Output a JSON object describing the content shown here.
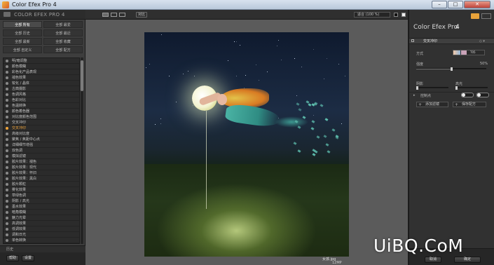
{
  "window": {
    "title": "Color Efex Pro 4",
    "min_label": "–",
    "max_label": "□",
    "close_label": "✕"
  },
  "left": {
    "title": "COLOR EFEX PRO 4",
    "categories": [
      "全部 所有",
      "全部 最爱",
      "全部 历史",
      "全部 最近",
      "全部 最新",
      "全部 收藏",
      "全部 自定义",
      "全部 配方"
    ],
    "filters": [
      "明/暗调整",
      "颜色模糊",
      "彩色化产品表现",
      "褪色效果",
      "锐化 / 晶体",
      "古典摄影",
      "色调风格",
      "色彩对比",
      "色温转换",
      "颜色着色器",
      "对比度颜色范围",
      "交叉冲印",
      "交叉冲印",
      "高级对比度",
      "聚焦 / 焦距中心点",
      "详细细节增强",
      "双色调",
      "模拟滤镜",
      "胶片效果：褪色",
      "胶片效果：现代",
      "胶片效果：怀旧",
      "胶片效果：黑白",
      "胶片颗粒",
      "雾化效果",
      "草绿色调",
      "阴影 / 高光",
      "墨水效果",
      "暗角模糊",
      "魅力光晕",
      "高调效果",
      "低调效果",
      "调和日光",
      "单色转换",
      "单色：黑白转换"
    ],
    "selected_filter": "交叉冲印",
    "history_label": "历史",
    "help_label": "帮助",
    "settings_label": "设置"
  },
  "toolbar": {
    "compare_label": "对比",
    "zoom_label": "适合 (100 %)",
    "background_black": "black",
    "background_white": "white"
  },
  "image": {
    "caption_file": "女孩.jpg",
    "caption_size": "12MP"
  },
  "right": {
    "product": "Color Efex Pro",
    "version": "4",
    "active_filter": "交叉冲印",
    "filter_control": "◇ ▾",
    "method_label": "方式",
    "method_value": "T05",
    "strength_label": "强度",
    "strength_value": "50%",
    "strength": 0.5,
    "shadow_label": "阴影",
    "highlight_label": "高光",
    "shadow": 0.0,
    "highlight": 0.0,
    "control_points_label": "控制点",
    "add_filter_label": "添加滤镜",
    "save_recipe_label": "保存配方",
    "cancel_label": "取消",
    "save_label": "确定"
  },
  "watermark": "UiBQ.CoM",
  "colors": {
    "accent": "#f0a43a",
    "panel": "#313131",
    "canvas": "#5b5b5b"
  }
}
